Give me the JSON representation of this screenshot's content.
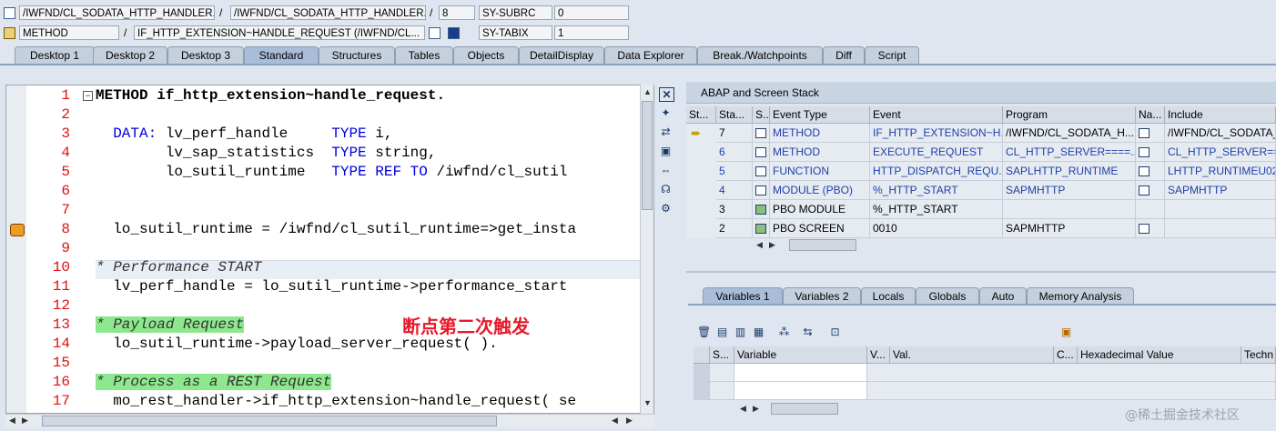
{
  "header": {
    "row1": {
      "field1": "/IWFND/CL_SODATA_HTTP_HANDLER...",
      "sep1": "/",
      "field2": "/IWFND/CL_SODATA_HTTP_HANDLER...",
      "sep2": "/",
      "field3": "8",
      "var_name": "SY-SUBRC",
      "var_value": "0"
    },
    "row2": {
      "field1": "METHOD",
      "sep1": "/",
      "field2": "IF_HTTP_EXTENSION~HANDLE_REQUEST (/IWFND/CL...",
      "var_name": "SY-TABIX",
      "var_value": "1"
    }
  },
  "tabs": [
    "Desktop 1",
    "Desktop 2",
    "Desktop 3",
    "Standard",
    "Structures",
    "Tables",
    "Objects",
    "DetailDisplay",
    "Data Explorer",
    "Break./Watchpoints",
    "Diff",
    "Script"
  ],
  "active_tab": "Standard",
  "editor": {
    "lines": [
      {
        "no": "1",
        "code": "METHOD if_http_extension~handle_request."
      },
      {
        "no": "2",
        "code": ""
      },
      {
        "no": "3",
        "code": "  DATA: lv_perf_handle     TYPE i,"
      },
      {
        "no": "4",
        "code": "        lv_sap_statistics  TYPE string,"
      },
      {
        "no": "5",
        "code": "        lo_sutil_runtime   TYPE REF TO /iwfnd/cl_sutil"
      },
      {
        "no": "6",
        "code": ""
      },
      {
        "no": "7",
        "code": ""
      },
      {
        "no": "8",
        "code": "  lo_sutil_runtime = /iwfnd/cl_sutil_runtime=>get_insta"
      },
      {
        "no": "9",
        "code": ""
      },
      {
        "no": "10",
        "code": "* Performance START"
      },
      {
        "no": "11",
        "code": "  lv_perf_handle = lo_sutil_runtime->performance_start"
      },
      {
        "no": "12",
        "code": ""
      },
      {
        "no": "13",
        "code": "* Payload Request"
      },
      {
        "no": "14",
        "code": "  lo_sutil_runtime->payload_server_request( )."
      },
      {
        "no": "15",
        "code": ""
      },
      {
        "no": "16",
        "code": "* Process as a REST Request"
      },
      {
        "no": "17",
        "code": "  mo_rest_handler->if_http_extension~handle_request( se"
      }
    ],
    "annotation": "断点第二次触发"
  },
  "stack": {
    "title": "ABAP and Screen Stack",
    "columns": [
      "St...",
      "Sta...",
      "S...",
      "Event Type",
      "Event",
      "Program",
      "Na...",
      "Include"
    ],
    "rows": [
      {
        "level": "7",
        "type": "METHOD",
        "event": "IF_HTTP_EXTENSION~H...",
        "program": "/IWFND/CL_SODATA_H...",
        "include": "/IWFND/CL_SODATA_..."
      },
      {
        "level": "6",
        "type": "METHOD",
        "event": "EXECUTE_REQUEST",
        "program": "CL_HTTP_SERVER====...",
        "include": "CL_HTTP_SERVER===="
      },
      {
        "level": "5",
        "type": "FUNCTION",
        "event": "HTTP_DISPATCH_REQU...",
        "program": "SAPLHTTP_RUNTIME",
        "include": "LHTTP_RUNTIMEU02"
      },
      {
        "level": "4",
        "type": "MODULE (PBO)",
        "event": "%_HTTP_START",
        "program": "SAPMHTTP",
        "include": "SAPMHTTP"
      },
      {
        "level": "3",
        "type": "PBO MODULE",
        "event": "%_HTTP_START",
        "program": "",
        "include": ""
      },
      {
        "level": "2",
        "type": "PBO SCREEN",
        "event": "0010",
        "program": "SAPMHTTP",
        "include": ""
      }
    ]
  },
  "variables": {
    "tabs": [
      "Variables 1",
      "Variables 2",
      "Locals",
      "Globals",
      "Auto",
      "Memory Analysis"
    ],
    "active_tab": "Variables 1",
    "columns": [
      "S...",
      "Variable",
      "V...",
      "Val.",
      "C...",
      "Hexadecimal Value",
      "Techn"
    ]
  },
  "watermark": "@稀土掘金技术社区"
}
